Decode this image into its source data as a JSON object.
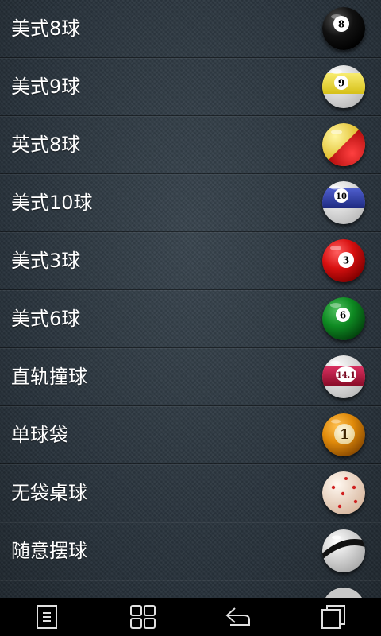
{
  "games": [
    {
      "label": "美式8球",
      "ball_icon": "eight-ball-icon",
      "color": "#111111",
      "stripe": false,
      "number": "8"
    },
    {
      "label": "美式9球",
      "ball_icon": "nine-ball-icon",
      "color": "#f2e03a",
      "stripe": true,
      "number": "9"
    },
    {
      "label": "英式8球",
      "ball_icon": "english-eight-ball-icon",
      "color": "#e8c421",
      "stripe": false,
      "number": ""
    },
    {
      "label": "美式10球",
      "ball_icon": "ten-ball-icon",
      "color": "#2f3fa8",
      "stripe": true,
      "number": "10"
    },
    {
      "label": "美式3球",
      "ball_icon": "three-ball-icon",
      "color": "#d81010",
      "stripe": false,
      "number": "3"
    },
    {
      "label": "美式6球",
      "ball_icon": "six-ball-icon",
      "color": "#0e8a22",
      "stripe": false,
      "number": "6"
    },
    {
      "label": "直轨撞球",
      "ball_icon": "straight-pool-ball-icon",
      "color": "#b8163a",
      "stripe": true,
      "number": "14.1"
    },
    {
      "label": "单球袋",
      "ball_icon": "one-pocket-ball-icon",
      "color": "#e79a0f",
      "stripe": false,
      "number": "1"
    },
    {
      "label": "无袋桌球",
      "ball_icon": "carom-ball-icon",
      "color": "#f4dcc8",
      "stripe": false,
      "number": ""
    },
    {
      "label": "随意摆球",
      "ball_icon": "custom-ball-icon",
      "color": "#eeeeee",
      "stripe": false,
      "number": ""
    }
  ],
  "navbar": {
    "items": [
      {
        "icon": "menu-icon"
      },
      {
        "icon": "grid-icon"
      },
      {
        "icon": "back-icon"
      },
      {
        "icon": "recent-apps-icon"
      }
    ]
  }
}
